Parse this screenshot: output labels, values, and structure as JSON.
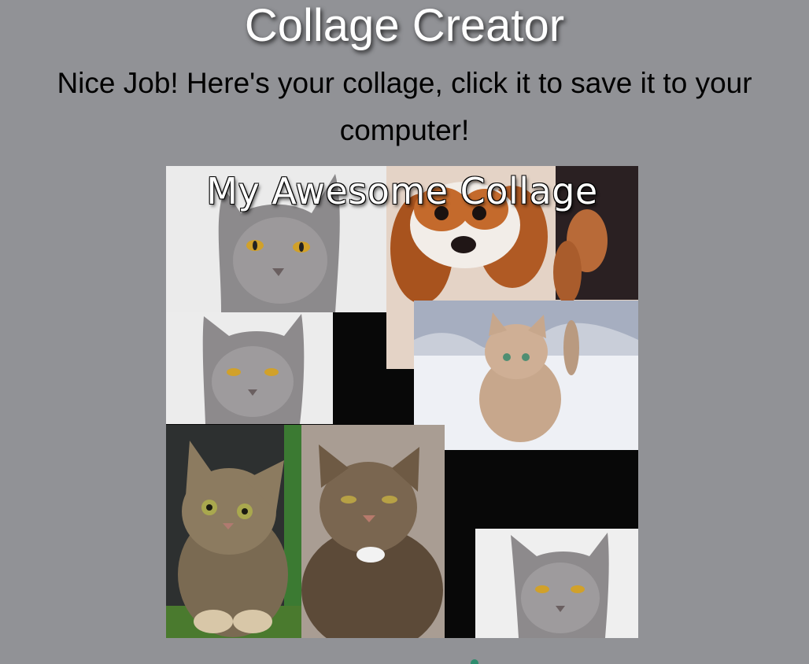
{
  "header": {
    "title": "Collage Creator",
    "message": "Nice Job! Here's your collage, click it to save it to your computer!"
  },
  "collage": {
    "caption": "My Awesome Collage",
    "background_color": "#080808",
    "photos": [
      {
        "subject": "gray-cat"
      },
      {
        "subject": "spaniel-dog"
      },
      {
        "subject": "gray-cat"
      },
      {
        "subject": "snow-cat"
      },
      {
        "subject": "tabby-kitten"
      },
      {
        "subject": "tabby-cat"
      },
      {
        "subject": "gray-cat"
      }
    ]
  },
  "colors": {
    "page_background": "#919296",
    "title_text": "#ffffff",
    "message_text": "#000000"
  }
}
